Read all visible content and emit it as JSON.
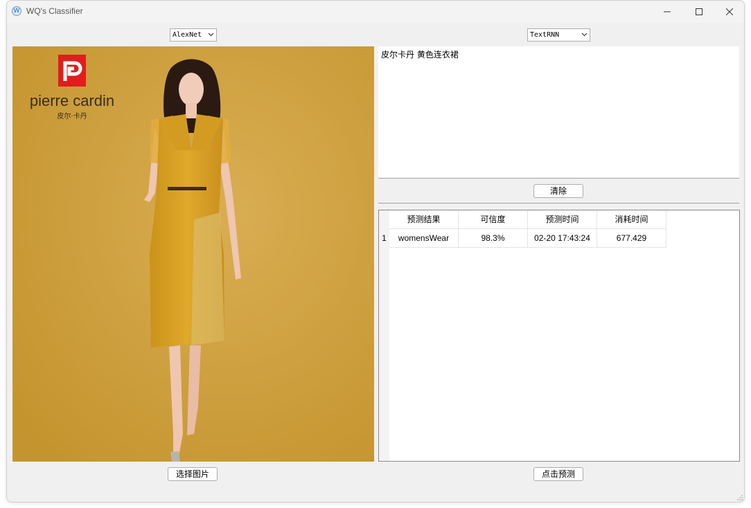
{
  "window": {
    "title": "WQ's Classifier"
  },
  "image_model_select": {
    "selected": "AlexNet"
  },
  "text_model_select": {
    "selected": "TextRNN"
  },
  "image": {
    "brand_name": "pierre cardin",
    "brand_sub": "皮尔·卡丹",
    "colors": {
      "background": "#cda03c",
      "dress": "#d9a326",
      "logo_red": "#e11d1d"
    }
  },
  "text_input": {
    "value": "皮尔卡丹 黄色连衣裙"
  },
  "buttons": {
    "clear_label": "清除",
    "select_image_label": "选择图片",
    "predict_label": "点击预测"
  },
  "results_table": {
    "columns": [
      "预测结果",
      "可信度",
      "预测时间",
      "消耗时间"
    ],
    "rows": [
      {
        "index": "1",
        "cells": [
          "womensWear",
          "98.3%",
          "02-20 17:43:24",
          "677.429"
        ]
      }
    ]
  }
}
